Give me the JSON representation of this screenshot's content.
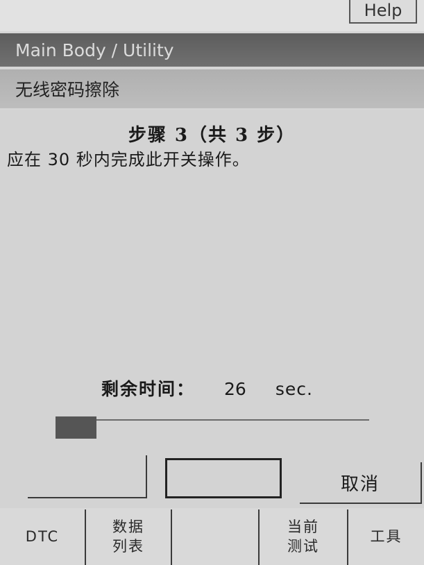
{
  "header": {
    "help_label": "Help"
  },
  "title": "Main Body / Utility",
  "subtitle": "无线密码擦除",
  "step_text": "步骤 3（共 3 步）",
  "instruction": "应在 30 秒内完成此开关操作。",
  "timer": {
    "label": "剩余时间：",
    "value": "26",
    "unit": "sec."
  },
  "progress": {
    "fraction": 0.13
  },
  "buttons": {
    "left": "",
    "middle": "",
    "cancel": "取消"
  },
  "tabs": [
    {
      "line1": "DTC",
      "line2": ""
    },
    {
      "line1": "数据",
      "line2": "列表"
    },
    {
      "line1": "",
      "line2": ""
    },
    {
      "line1": "当前",
      "line2": "测试"
    },
    {
      "line1": "工具",
      "line2": ""
    }
  ]
}
